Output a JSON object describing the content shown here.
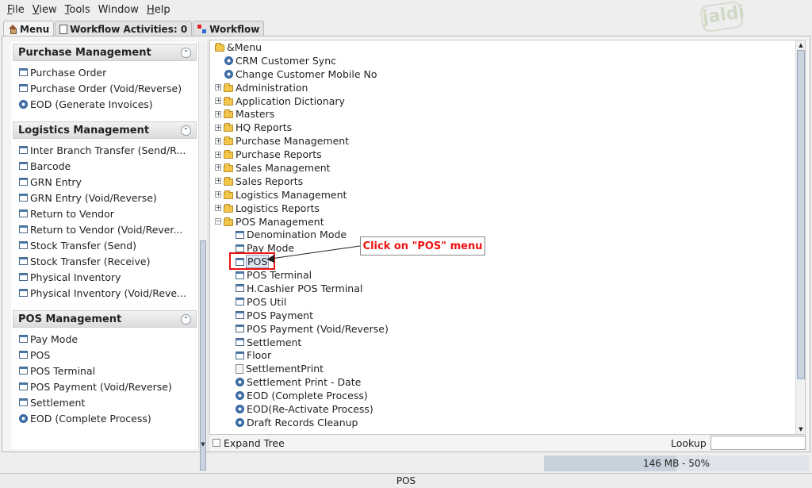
{
  "menubar": [
    {
      "label": "File",
      "ul": "F",
      "rest": "ile"
    },
    {
      "label": "View",
      "ul": "V",
      "rest": "iew"
    },
    {
      "label": "Tools",
      "ul": "T",
      "rest": "ools"
    },
    {
      "label": "Window",
      "ul": "",
      "rest": "Window"
    },
    {
      "label": "Help",
      "ul": "H",
      "rest": "elp"
    }
  ],
  "logo": "jaldi",
  "tabs": {
    "menu": "Menu",
    "activities": "Workflow Activities: 0",
    "workflow": "Workflow"
  },
  "left_panel": {
    "groups": [
      {
        "title": "Purchase Management",
        "items": [
          {
            "label": "Purchase Order",
            "icon": "window-icon"
          },
          {
            "label": "Purchase Order (Void/Reverse)",
            "icon": "window-icon"
          },
          {
            "label": "EOD (Generate Invoices)",
            "icon": "process-icon"
          }
        ]
      },
      {
        "title": "Logistics Management",
        "items": [
          {
            "label": "Inter Branch Transfer (Send/R...",
            "icon": "window-icon"
          },
          {
            "label": "Barcode",
            "icon": "window-icon"
          },
          {
            "label": "GRN Entry",
            "icon": "window-icon"
          },
          {
            "label": "GRN Entry (Void/Reverse)",
            "icon": "window-icon"
          },
          {
            "label": "Return to Vendor",
            "icon": "window-icon"
          },
          {
            "label": "Return to Vendor (Void/Rever...",
            "icon": "window-icon"
          },
          {
            "label": "Stock Transfer (Send)",
            "icon": "window-icon"
          },
          {
            "label": "Stock Transfer (Receive)",
            "icon": "window-icon"
          },
          {
            "label": "Physical Inventory",
            "icon": "window-icon"
          },
          {
            "label": "Physical Inventory (Void/Reve...",
            "icon": "window-icon"
          }
        ]
      },
      {
        "title": "POS Management",
        "items": [
          {
            "label": "Pay Mode",
            "icon": "window-icon"
          },
          {
            "label": "POS",
            "icon": "window-icon"
          },
          {
            "label": "POS Terminal",
            "icon": "window-icon"
          },
          {
            "label": "POS Payment (Void/Reverse)",
            "icon": "window-icon"
          },
          {
            "label": "Settlement",
            "icon": "window-icon"
          },
          {
            "label": "EOD (Complete Process)",
            "icon": "process-icon"
          }
        ]
      }
    ]
  },
  "tree": {
    "root": "&Menu",
    "nodes": [
      {
        "label": "CRM Customer Sync",
        "type": "process",
        "level": 1
      },
      {
        "label": "Change Customer Mobile No",
        "type": "process",
        "level": 1
      },
      {
        "label": "Administration",
        "type": "folder",
        "level": 1
      },
      {
        "label": "Application Dictionary",
        "type": "folder",
        "level": 1
      },
      {
        "label": "Masters",
        "type": "folder",
        "level": 1
      },
      {
        "label": "HQ Reports",
        "type": "folder",
        "level": 1
      },
      {
        "label": "Purchase Management",
        "type": "folder",
        "level": 1
      },
      {
        "label": "Purchase Reports",
        "type": "folder",
        "level": 1
      },
      {
        "label": "Sales Management",
        "type": "folder",
        "level": 1
      },
      {
        "label": "Sales Reports",
        "type": "folder",
        "level": 1
      },
      {
        "label": "Logistics Management",
        "type": "folder",
        "level": 1
      },
      {
        "label": "Logistics Reports",
        "type": "folder",
        "level": 1
      },
      {
        "label": "POS Management",
        "type": "open-folder",
        "level": 1
      },
      {
        "label": "Denomination Mode",
        "type": "window",
        "level": 2
      },
      {
        "label": "Pay Mode",
        "type": "window",
        "level": 2
      },
      {
        "label": "POS",
        "type": "window",
        "level": 2,
        "selected": true
      },
      {
        "label": "POS Terminal",
        "type": "window",
        "level": 2
      },
      {
        "label": "H.Cashier POS Terminal",
        "type": "window",
        "level": 2
      },
      {
        "label": "POS Util",
        "type": "window",
        "level": 2
      },
      {
        "label": "POS Payment",
        "type": "window",
        "level": 2
      },
      {
        "label": "POS Payment (Void/Reverse)",
        "type": "window",
        "level": 2
      },
      {
        "label": "Settlement",
        "type": "window",
        "level": 2
      },
      {
        "label": "Floor",
        "type": "window",
        "level": 2
      },
      {
        "label": "SettlementPrint",
        "type": "report",
        "level": 2
      },
      {
        "label": "Settlement Print - Date",
        "type": "process",
        "level": 2
      },
      {
        "label": "EOD (Complete Process)",
        "type": "process",
        "level": 2
      },
      {
        "label": "EOD(Re-Activate Process)",
        "type": "process",
        "level": 2
      },
      {
        "label": "Draft Records Cleanup",
        "type": "process",
        "level": 2
      }
    ]
  },
  "callout": "Click on \"POS\" menu",
  "bottom": {
    "expand_tree": "Expand Tree",
    "lookup": "Lookup"
  },
  "memory": {
    "text": "146 MB - 50%",
    "fill": 0.5
  },
  "status": "POS"
}
